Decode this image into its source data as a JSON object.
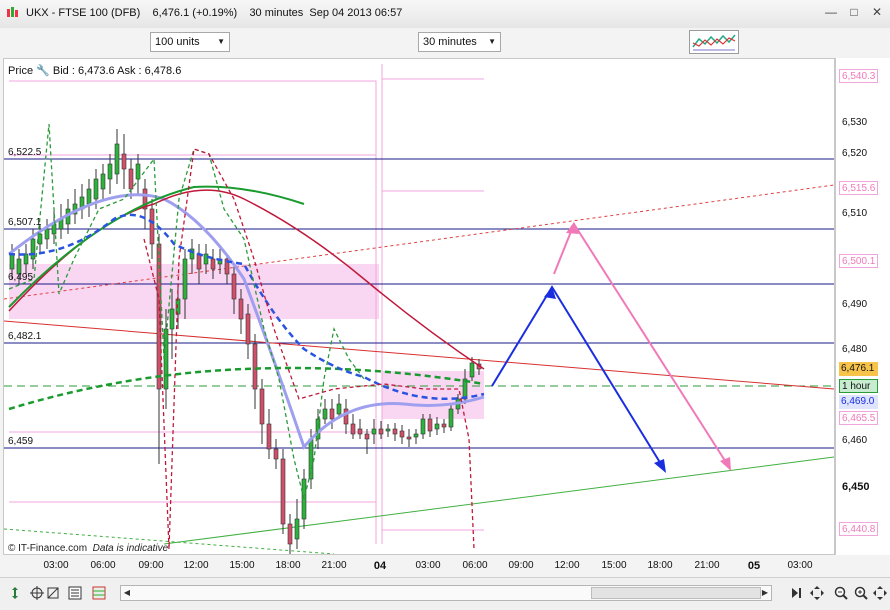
{
  "window": {
    "title": "UKX - FTSE 100 (DFB)    6,476.1 (+0.19%)    30 minutes  Sep 04 2013 06:57"
  },
  "toolbar": {
    "units_select": "100 units",
    "timeframe_select": "30 minutes"
  },
  "info": {
    "price_label": "Price",
    "bid_ask": "Bid : 6,473.6 Ask : 6,478.6"
  },
  "horizontal_levels": [
    "6,522.5",
    "6,507.1",
    "6,495",
    "6,482.1",
    "6,459"
  ],
  "y_axis": {
    "ticks": [
      "6,530",
      "6,520",
      "6,510",
      "6,500",
      "6,490",
      "6,480",
      "6,470",
      "6,460",
      "6,450"
    ],
    "tags": {
      "top_pink": "6,540.3",
      "pink2": "6,515.6",
      "pink3": "6,500.1",
      "last": "6,476.1",
      "hour": "1 hour",
      "blue": "6,469.0",
      "pink4": "6,465.5",
      "bottom_pink": "6,440.8"
    }
  },
  "x_axis": {
    "labels": [
      "03:00",
      "06:00",
      "09:00",
      "12:00",
      "15:00",
      "18:00",
      "21:00",
      "04",
      "03:00",
      "06:00",
      "09:00",
      "12:00",
      "15:00",
      "18:00",
      "21:00",
      "05",
      "03:00"
    ]
  },
  "footer": {
    "source": "© IT-Finance.com",
    "note": "Data is indicative"
  },
  "colors": {
    "blue_line": "#1f3fe0",
    "pink_line": "#f07ab8",
    "red_ma": "#c0183a",
    "green_ma": "#1a9b2f",
    "lavender_ma": "#9f9ff0",
    "up_candle": "#2db33c",
    "down_candle": "#d0506a",
    "zone_fill": "#f7c8ee"
  },
  "icons": [
    "app-icon",
    "minimize-icon",
    "maximize-icon",
    "close-icon",
    "chart-type-icon",
    "wrench-icon",
    "crosshair-icon",
    "zoom-in-icon",
    "zoom-out-icon",
    "pan-icon"
  ]
}
